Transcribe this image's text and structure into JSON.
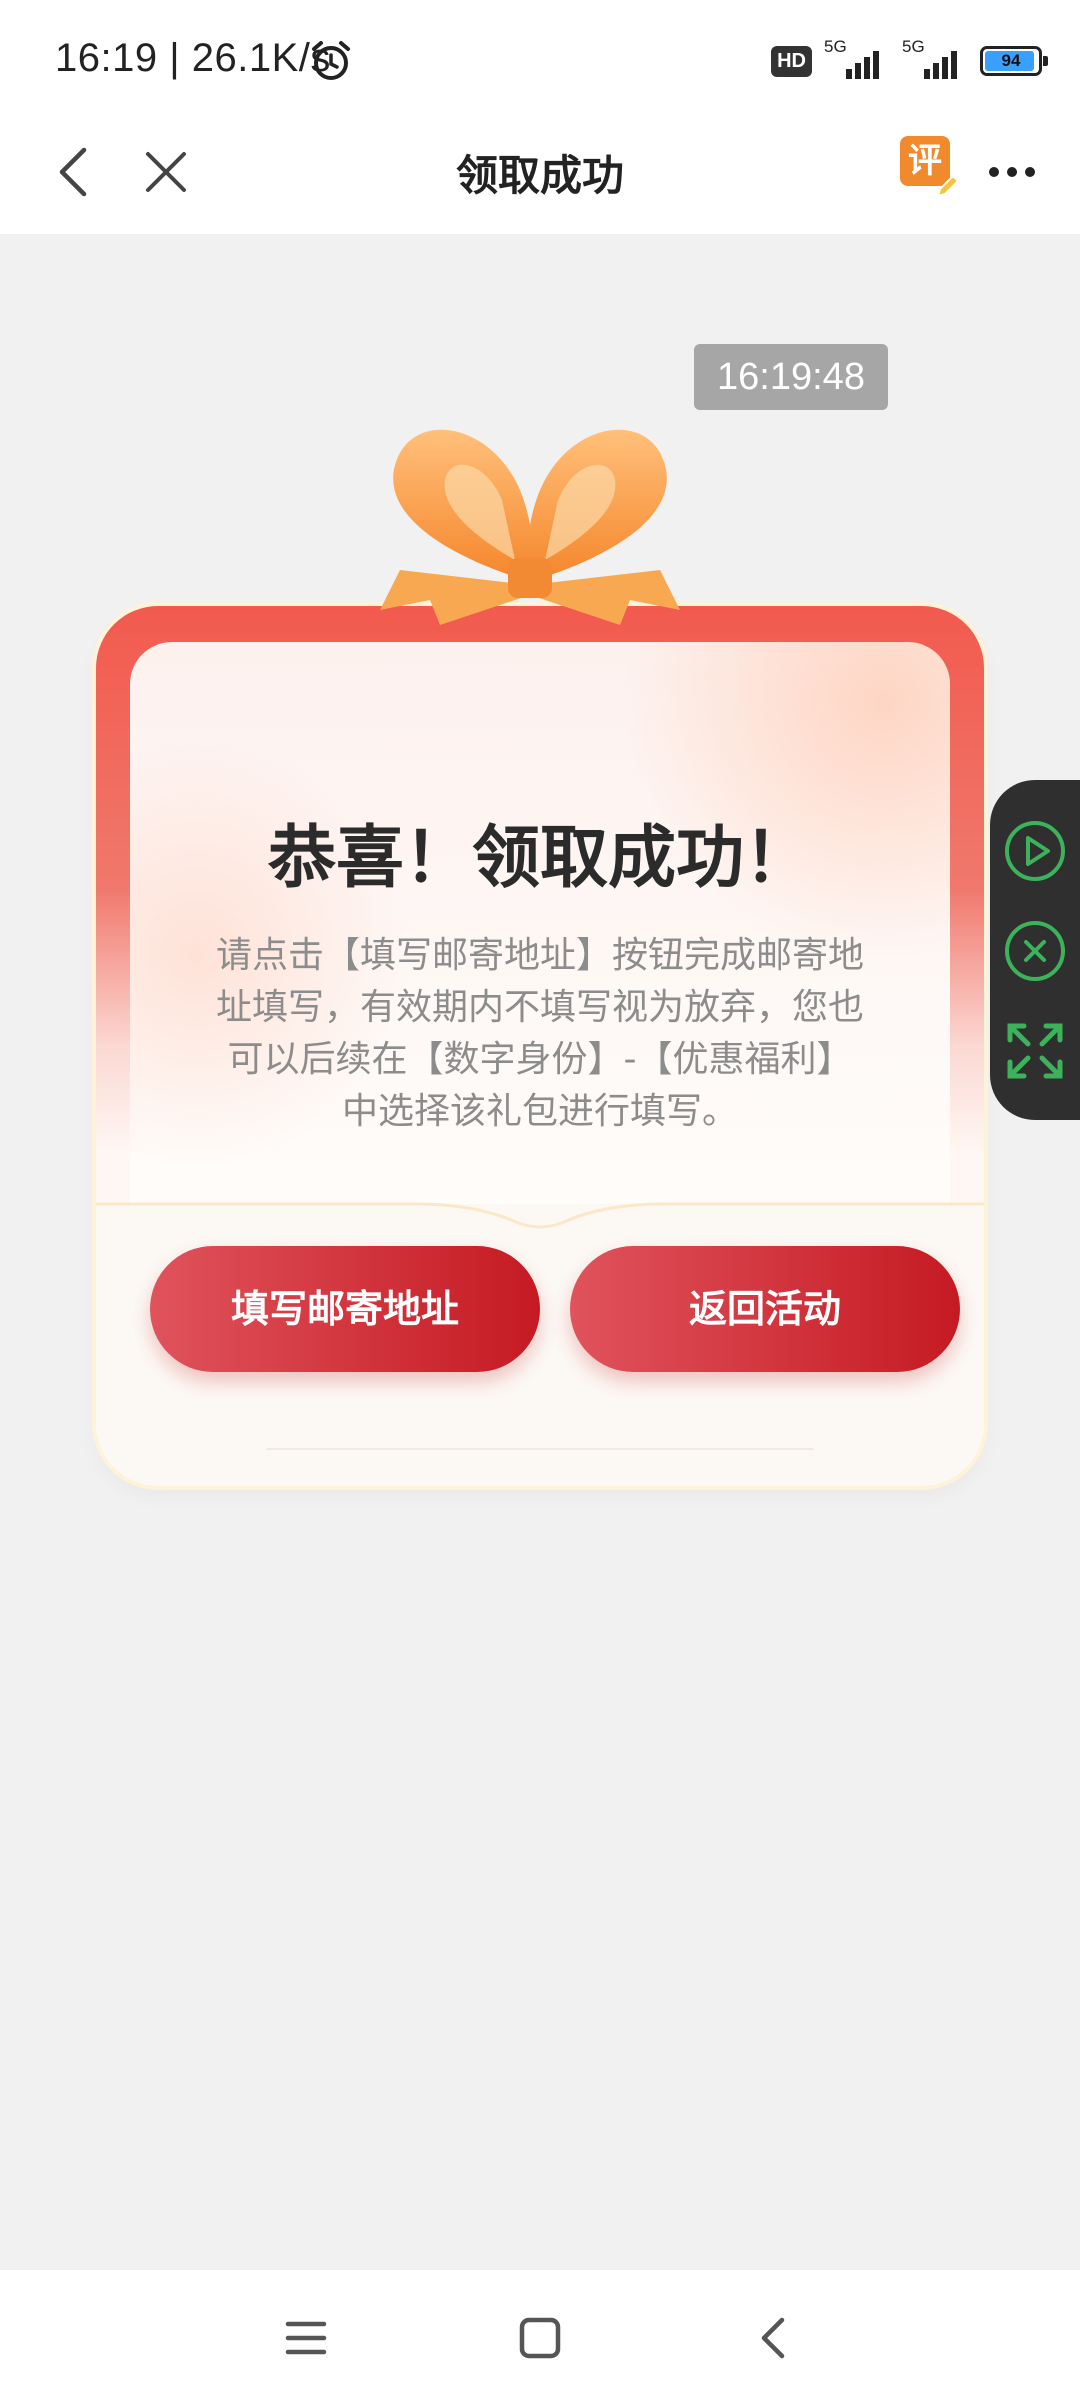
{
  "status_bar": {
    "time": "16:19 | 26.1K/s",
    "hd_label": "HD",
    "network_1": "5G",
    "network_2": "5G",
    "battery": "94",
    "battery_level": 0.94,
    "icons": [
      "alarm-icon",
      "signal-icon",
      "battery-icon"
    ]
  },
  "nav": {
    "title": "领取成功",
    "review_label": "评",
    "icons": [
      "back-icon",
      "close-icon",
      "review-icon",
      "more-icon"
    ]
  },
  "timestamp": "16:19:48",
  "card": {
    "title": "恭喜！领取成功！",
    "description": "请点击【填写邮寄地址】按钮完成邮寄地址填写，有效期内不填写视为放弃，您也可以后续在【数字身份】-【优惠福利】中选择该礼包进行填写。",
    "fill_button": "填写邮寄地址",
    "back_button": "返回活动"
  },
  "float_controls": {
    "icons": [
      "play-icon",
      "close-circle-icon",
      "expand-icon"
    ],
    "accent": "#3cb35a"
  },
  "system_nav": {
    "icons": [
      "menu-icon",
      "home-icon",
      "back-icon"
    ]
  },
  "colors": {
    "button_start": "#e0535c",
    "button_end": "#c51a23",
    "card_red": "#f25a4e",
    "ribbon": "#f7a23c"
  }
}
